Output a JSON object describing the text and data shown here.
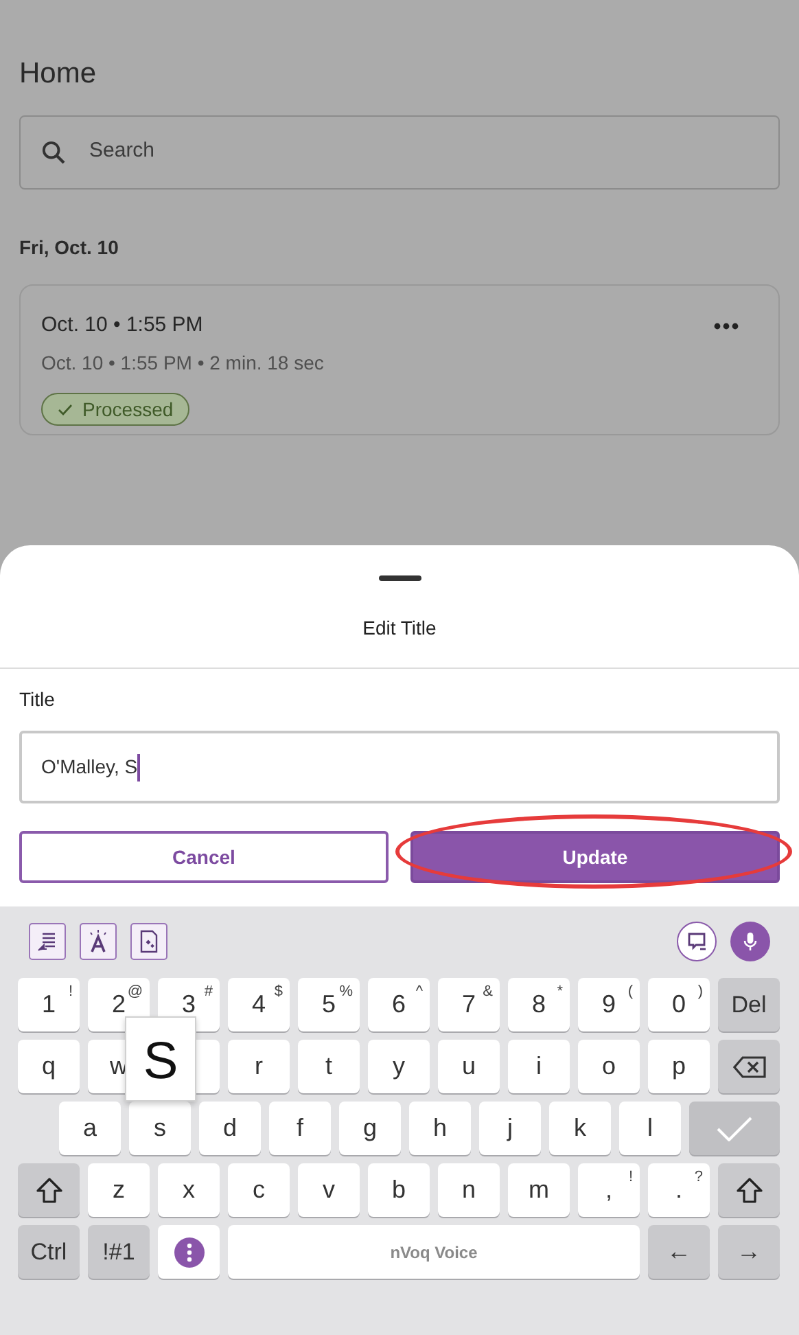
{
  "page": {
    "title": "Home",
    "search": {
      "placeholder": "Search"
    },
    "sections": [
      {
        "date": "Fri, Oct. 10",
        "recordings": [
          {
            "title": "Oct. 10 • 1:55 PM",
            "details": "Oct. 10 • 1:55 PM • 2 min. 18 sec",
            "status": "Processed"
          }
        ]
      }
    ]
  },
  "sheet": {
    "title": "Edit Title",
    "field": {
      "label": "Title",
      "value": "O'Malley, S",
      "focused": true
    },
    "buttons": [
      {
        "label": "Cancel",
        "kind": "secondary",
        "highlighted": false
      },
      {
        "label": "Update",
        "kind": "primary",
        "highlighted": true
      }
    ]
  },
  "keyboard": {
    "key_rows": [
      {
        "keys": [
          {
            "label": "1",
            "hint": "!",
            "kind": "char"
          },
          {
            "label": "2",
            "hint": "@",
            "kind": "char"
          },
          {
            "label": "3",
            "hint": "#",
            "kind": "char"
          },
          {
            "label": "4",
            "hint": "$",
            "kind": "char"
          },
          {
            "label": "5",
            "hint": "%",
            "kind": "char"
          },
          {
            "label": "6",
            "hint": "^",
            "kind": "char"
          },
          {
            "label": "7",
            "hint": "&",
            "kind": "char"
          },
          {
            "label": "8",
            "hint": "*",
            "kind": "char"
          },
          {
            "label": "9",
            "hint": "(",
            "kind": "char"
          },
          {
            "label": "0",
            "hint": ")",
            "kind": "char"
          },
          {
            "label": "Del",
            "kind": "fn"
          }
        ]
      },
      {
        "keys": [
          {
            "label": "q",
            "kind": "char"
          },
          {
            "label": "w",
            "kind": "char"
          },
          {
            "kind": "char"
          },
          {
            "label": "r",
            "kind": "char"
          },
          {
            "label": "t",
            "kind": "char"
          },
          {
            "label": "y",
            "kind": "char"
          },
          {
            "label": "u",
            "kind": "char"
          },
          {
            "label": "i",
            "kind": "char"
          },
          {
            "label": "o",
            "kind": "char"
          },
          {
            "label": "p",
            "kind": "char"
          },
          {
            "kind": "backspace"
          }
        ]
      },
      {
        "indent": true,
        "keys": [
          {
            "label": "a",
            "kind": "char"
          },
          {
            "label": "s",
            "kind": "char"
          },
          {
            "label": "d",
            "kind": "char"
          },
          {
            "label": "f",
            "kind": "char"
          },
          {
            "label": "g",
            "kind": "char"
          },
          {
            "label": "h",
            "kind": "char"
          },
          {
            "label": "j",
            "kind": "char"
          },
          {
            "label": "k",
            "kind": "char"
          },
          {
            "label": "l",
            "kind": "char"
          },
          {
            "kind": "enter"
          }
        ]
      },
      {
        "keys": [
          {
            "kind": "shift"
          },
          {
            "label": "z",
            "kind": "char"
          },
          {
            "label": "x",
            "kind": "char"
          },
          {
            "label": "c",
            "kind": "char"
          },
          {
            "label": "v",
            "kind": "char"
          },
          {
            "label": "b",
            "kind": "char"
          },
          {
            "label": "n",
            "kind": "char"
          },
          {
            "label": "m",
            "kind": "char"
          },
          {
            "label": ",",
            "hint": "!",
            "kind": "char"
          },
          {
            "label": ".",
            "hint": "?",
            "kind": "char"
          },
          {
            "kind": "shift"
          }
        ]
      },
      {
        "keys": [
          {
            "label": "Ctrl",
            "kind": "fn"
          },
          {
            "label": "!#1",
            "kind": "fn"
          },
          {
            "kind": "menu"
          },
          {
            "label": "nVoq Voice",
            "kind": "space"
          },
          {
            "label": "←",
            "kind": "fn"
          },
          {
            "label": "→",
            "kind": "fn"
          }
        ]
      }
    ],
    "key_preview": "S"
  }
}
